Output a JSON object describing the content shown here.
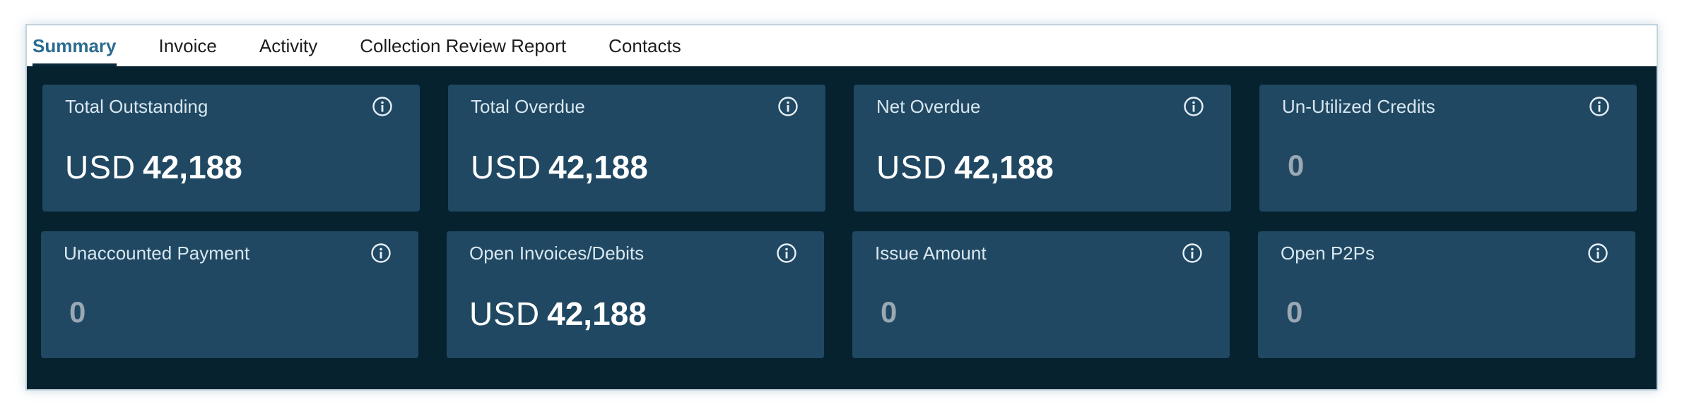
{
  "tabs": [
    {
      "label": "Summary",
      "active": true
    },
    {
      "label": "Invoice",
      "active": false
    },
    {
      "label": "Activity",
      "active": false
    },
    {
      "label": "Collection Review Report",
      "active": false
    },
    {
      "label": "Contacts",
      "active": false
    }
  ],
  "cards": [
    {
      "label": "Total Outstanding",
      "currency": "USD",
      "amount": "42,188"
    },
    {
      "label": "Total Overdue",
      "currency": "USD",
      "amount": "42,188"
    },
    {
      "label": "Net Overdue",
      "currency": "USD",
      "amount": "42,188"
    },
    {
      "label": "Un-Utilized Credits",
      "currency": "",
      "amount": "0"
    },
    {
      "label": "Unaccounted Payment",
      "currency": "",
      "amount": "0"
    },
    {
      "label": "Open Invoices/Debits",
      "currency": "USD",
      "amount": "42,188"
    },
    {
      "label": "Issue Amount",
      "currency": "",
      "amount": "0"
    },
    {
      "label": "Open P2Ps",
      "currency": "",
      "amount": "0"
    }
  ],
  "icons": {
    "info": "info-circle-icon"
  },
  "colors": {
    "panel_bg": "#06222f",
    "card_bg": "#204862",
    "active_tab": "#2b6b90"
  }
}
